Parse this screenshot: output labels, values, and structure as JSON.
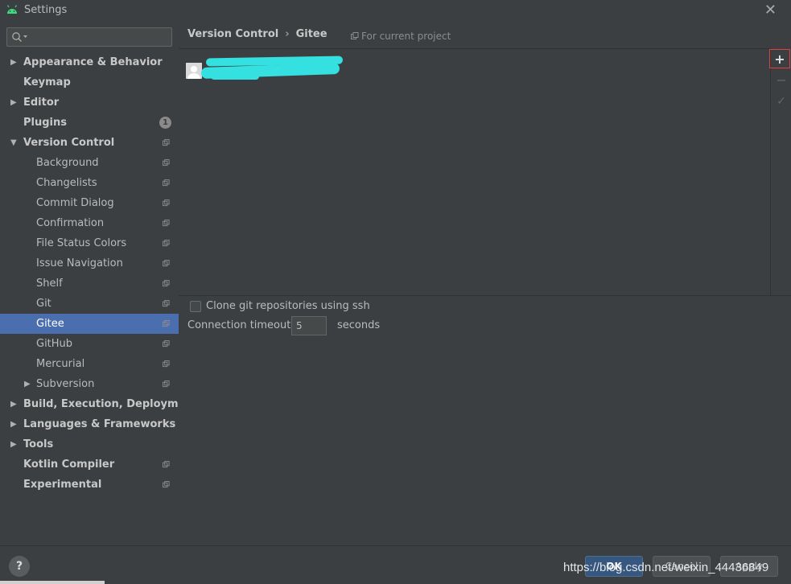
{
  "window": {
    "title": "Settings",
    "close_glyph": "✕"
  },
  "search": {
    "placeholder": ""
  },
  "sidebar": {
    "items": [
      {
        "label": "Appearance & Behavior",
        "level": 0,
        "arrow": "▶",
        "project": false
      },
      {
        "label": "Keymap",
        "level": 0,
        "arrow": "",
        "project": false
      },
      {
        "label": "Editor",
        "level": 0,
        "arrow": "▶",
        "project": false
      },
      {
        "label": "Plugins",
        "level": 0,
        "arrow": "",
        "project": false,
        "badge": "1"
      },
      {
        "label": "Version Control",
        "level": 0,
        "arrow": "▼",
        "project": true
      },
      {
        "label": "Background",
        "level": 1,
        "arrow": "",
        "project": true
      },
      {
        "label": "Changelists",
        "level": 1,
        "arrow": "",
        "project": true
      },
      {
        "label": "Commit Dialog",
        "level": 1,
        "arrow": "",
        "project": true
      },
      {
        "label": "Confirmation",
        "level": 1,
        "arrow": "",
        "project": true
      },
      {
        "label": "File Status Colors",
        "level": 1,
        "arrow": "",
        "project": true
      },
      {
        "label": "Issue Navigation",
        "level": 1,
        "arrow": "",
        "project": true
      },
      {
        "label": "Shelf",
        "level": 1,
        "arrow": "",
        "project": true
      },
      {
        "label": "Git",
        "level": 1,
        "arrow": "",
        "project": true
      },
      {
        "label": "Gitee",
        "level": 1,
        "arrow": "",
        "project": true,
        "selected": true
      },
      {
        "label": "GitHub",
        "level": 1,
        "arrow": "",
        "project": true
      },
      {
        "label": "Mercurial",
        "level": 1,
        "arrow": "",
        "project": true
      },
      {
        "label": "Subversion",
        "level": 1,
        "arrow": "▶",
        "project": true
      },
      {
        "label": "Build, Execution, Deployment",
        "level": 0,
        "arrow": "▶",
        "project": false
      },
      {
        "label": "Languages & Frameworks",
        "level": 0,
        "arrow": "▶",
        "project": false
      },
      {
        "label": "Tools",
        "level": 0,
        "arrow": "▶",
        "project": false
      },
      {
        "label": "Kotlin Compiler",
        "level": 0,
        "arrow": "",
        "project": true
      },
      {
        "label": "Experimental",
        "level": 0,
        "arrow": "",
        "project": true
      }
    ]
  },
  "breadcrumb": {
    "parent": "Version Control",
    "separator": "›",
    "current": "Gitee"
  },
  "scope": {
    "label": "For current project"
  },
  "toolbar": {
    "add_glyph": "+",
    "remove_glyph": "−",
    "check_glyph": "✓"
  },
  "options": {
    "clone_ssh_label": "Clone git repositories using ssh",
    "clone_ssh_checked": false,
    "timeout_label": "Connection timeout:",
    "timeout_value": "5",
    "timeout_unit": "seconds"
  },
  "footer": {
    "help_glyph": "?",
    "ok_label": "OK",
    "cancel_label": "Cancel",
    "apply_label": "Apply",
    "watermark": "https://blog.csdn.net/weixin_44436849"
  },
  "colors": {
    "selection": "#4b6eaf",
    "background": "#3c3f41",
    "redacted": "#34e0e0",
    "add_highlight": "#e04040"
  }
}
